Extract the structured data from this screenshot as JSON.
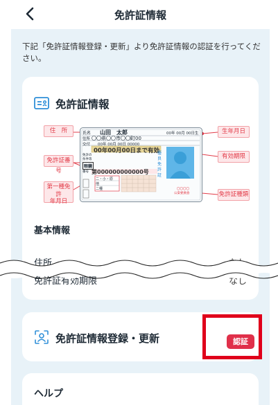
{
  "header": {
    "title": "免許証情報"
  },
  "intro_text": "下記「免許証情報登録・更新」より免許証情報の認証を行ってください。",
  "license_card": {
    "title": "免許証情報",
    "labels": {
      "address": "住　所",
      "license_number": "免許証番号",
      "first_class_date_line1": "第一種免許",
      "first_class_date_line2": "年月日",
      "birth_date": "生年月日",
      "expiry": "有効期限",
      "license_type": "免許証種類"
    },
    "sample": {
      "name_label": "氏名",
      "name": "山田　太郎",
      "birth": "00年 00月 00日生",
      "address_label": "住所",
      "address": "〇〇県〇〇市〇〇町00",
      "issue_label": "交付",
      "issue": "00年 00月 00日 00000",
      "expiry": "00年00月00日まで有効",
      "cond_label1": "免許の",
      "cond_label2": "条件等",
      "glasses": "眼鏡",
      "number_label": "番号",
      "number": "第000000000000号",
      "side1": "優",
      "side2": "良",
      "side3": "免",
      "side4": "許",
      "side5": "証",
      "issuer1": "〇〇〇〇",
      "issuer2": "公安委員会",
      "row1": "二・小・原",
      "row2": "他",
      "row3": "二種"
    },
    "basic_info_title": "基本情報",
    "rows": [
      {
        "label": "住所",
        "value": "なし"
      },
      {
        "label": "免許証有効期限",
        "value": "なし"
      }
    ]
  },
  "register_card": {
    "title": "免許証情報登録・更新",
    "badge": "認証"
  },
  "help_card": {
    "title": "ヘルプ"
  },
  "colors": {
    "accent": "#e0304a",
    "highlight": "#e0001b",
    "background": "#e8f2f8",
    "icon_blue": "#2f8fd8"
  }
}
